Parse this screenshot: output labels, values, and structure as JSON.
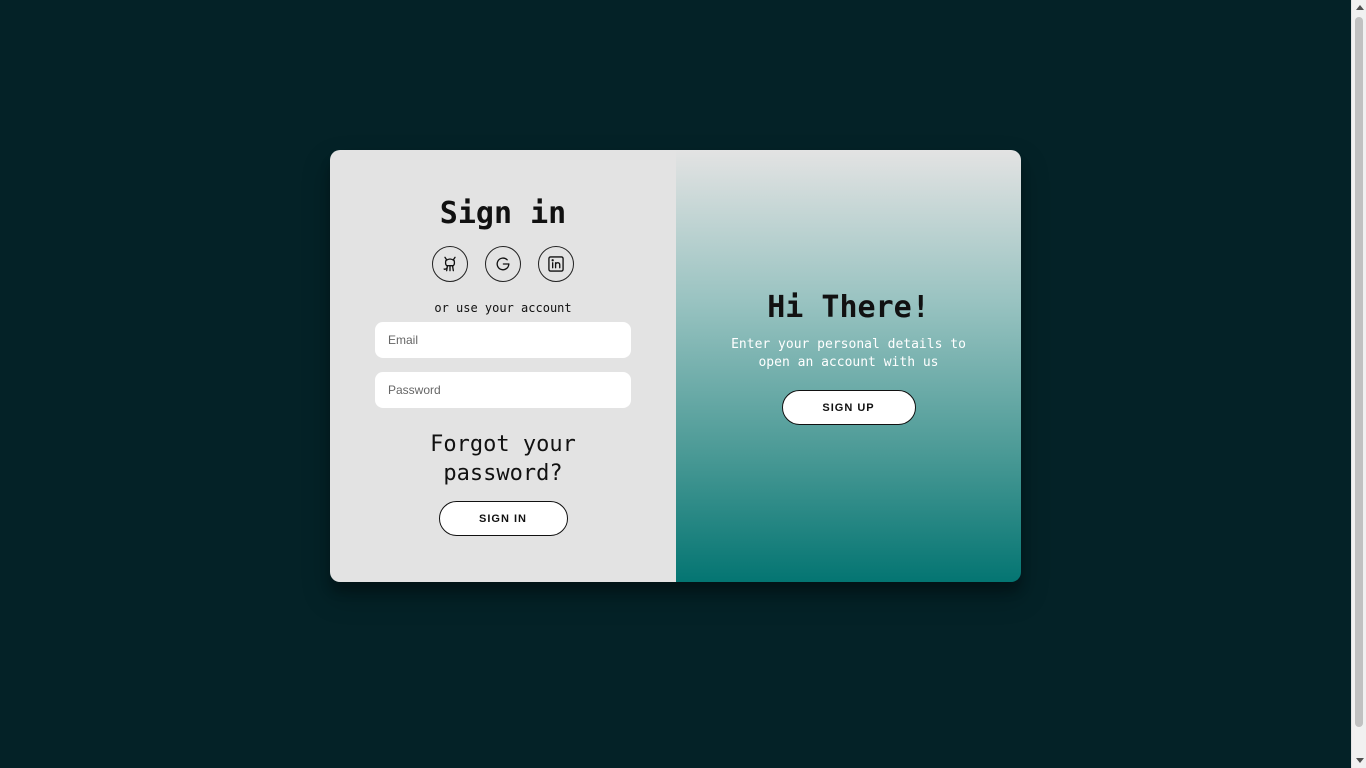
{
  "signin": {
    "title": "Sign in",
    "socials": [
      {
        "icon": "github-icon"
      },
      {
        "icon": "google-icon"
      },
      {
        "icon": "linkedin-icon"
      }
    ],
    "alt_text": "or use your account",
    "email_placeholder": "Email",
    "password_placeholder": "Password",
    "forgot_label": "Forgot your password?",
    "button_label": "SIGN IN"
  },
  "overlay": {
    "title": "Hi There!",
    "description": "Enter your personal details to open an account with us",
    "button_label": "SIGN UP"
  },
  "colors": {
    "background": "#042227",
    "left_panel": "#e3e3e3",
    "gradient_top": "#e3e3e3",
    "gradient_bottom": "#047572"
  }
}
